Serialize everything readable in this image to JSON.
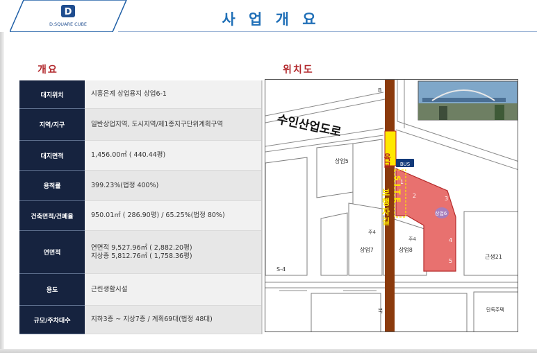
{
  "header": {
    "logo_text": "D.SQUARE CUBE",
    "title": "사 업 개 요"
  },
  "sections": {
    "overview_label": "개요",
    "location_label": "위치도"
  },
  "overview_rows": [
    {
      "key": "대지위치",
      "value": "시흥은계 상업용지 상업6-1"
    },
    {
      "key": "지역/지구",
      "value": "일반상업지역, 도시지역/제1종지구단위계획구역"
    },
    {
      "key": "대지면적",
      "value": "1,456.00㎡ ( 440.44평)"
    },
    {
      "key": "용적률",
      "value": "399.23%(법정 400%)"
    },
    {
      "key": "건축면적/건폐율",
      "value": "950.01㎡ ( 286.90평) / 65.25%(법정 80%)"
    },
    {
      "key": "연면적",
      "value": "연면적 9,527.96㎡ ( 2,882.20평)",
      "value2": "지상층 5,812.76㎡ ( 1,758.36평)"
    },
    {
      "key": "용도",
      "value": "근린생활시설"
    },
    {
      "key": "규모/주차대수",
      "value": "지하3층 ~ 지상7층 / 계획69대(법정 48대)"
    }
  ],
  "map": {
    "road_label": "수인산업도로",
    "bridge_label": "육교",
    "bus_label": "BUS",
    "site_label": "SITE",
    "walkway_label": "보행자길",
    "road_top_label": "B",
    "lots": {
      "s5": "상업5",
      "s7": "상업7",
      "s8": "상업8",
      "s4": "S-4",
      "k21": "근생21",
      "north": "북",
      "dandok": "단독주택",
      "site_lot": "상업6",
      "ju1": "주4",
      "ju2": "주4"
    },
    "parcel_numbers": [
      "1",
      "2",
      "3",
      "4",
      "5"
    ],
    "colors": {
      "site": "#e8716f",
      "walkway": "#8b3a0c",
      "bridge": "#ffe800",
      "bus": "#123a7a"
    }
  }
}
